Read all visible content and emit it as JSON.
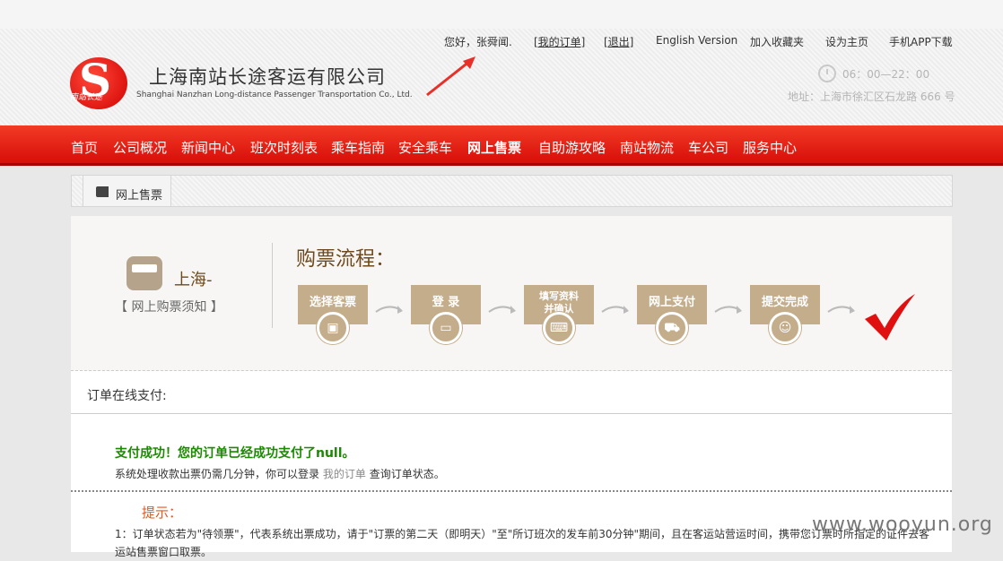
{
  "header": {
    "company_cn": "上海南站长途客运有限公司",
    "company_en": "Shanghai Nanzhan Long-distance Passenger Transportation Co., Ltd.",
    "logo_text": "南站长途",
    "greeting": "您好，张舜闻.",
    "links": [
      "[我的订单]",
      "[退出]",
      "English Version",
      "加入收藏夹",
      "设为主页",
      "手机APP下载"
    ],
    "hours": "06：00—22：00",
    "address": "地址：上海市徐汇区石龙路 666 号"
  },
  "nav": {
    "items": [
      "首页",
      "公司概况",
      "新闻中心",
      "班次时刻表",
      "乘车指南",
      "安全乘车",
      "网上售票",
      "自助游攻略",
      "南站物流",
      "车公司",
      "服务中心"
    ],
    "active": "网上售票"
  },
  "breadcrumb": {
    "label": "网上售票"
  },
  "flow": {
    "city": "上海-",
    "notice": "【 网上购票须知 】",
    "title": "购票流程：",
    "steps": [
      {
        "label": "选择客票",
        "icon": "bus-icon"
      },
      {
        "label": "登 录",
        "icon": "monitor-icon"
      },
      {
        "label": "填写资料\n并确认",
        "icon": "keyboard-icon"
      },
      {
        "label": "网上支付",
        "icon": "cart-icon"
      },
      {
        "label": "提交完成",
        "icon": "smile-icon"
      }
    ]
  },
  "payment": {
    "section_label": "订单在线支付:",
    "success": "支付成功！您的订单已经成功支付了null。",
    "sys_before": "系统处理收款出票仍需几分钟，你可以登录",
    "sys_link": "我的订单",
    "sys_after": "查询订单状态。",
    "tip_title": "提示：",
    "tip_text": "1：订单状态若为\"待领票\"，代表系统出票成功，请于\"订票的第二天（即明天）\"至\"所订班次的发车前30分钟\"期间，且在客运站营运时间，携带您订票时所指定的证件去客运站售票窗口取票。"
  },
  "watermark": "www.wooyun.org",
  "colors": {
    "nav": "#e01f15",
    "accent": "#c4ad8b",
    "success": "#1a8a00",
    "tip": "#e05a1f"
  }
}
